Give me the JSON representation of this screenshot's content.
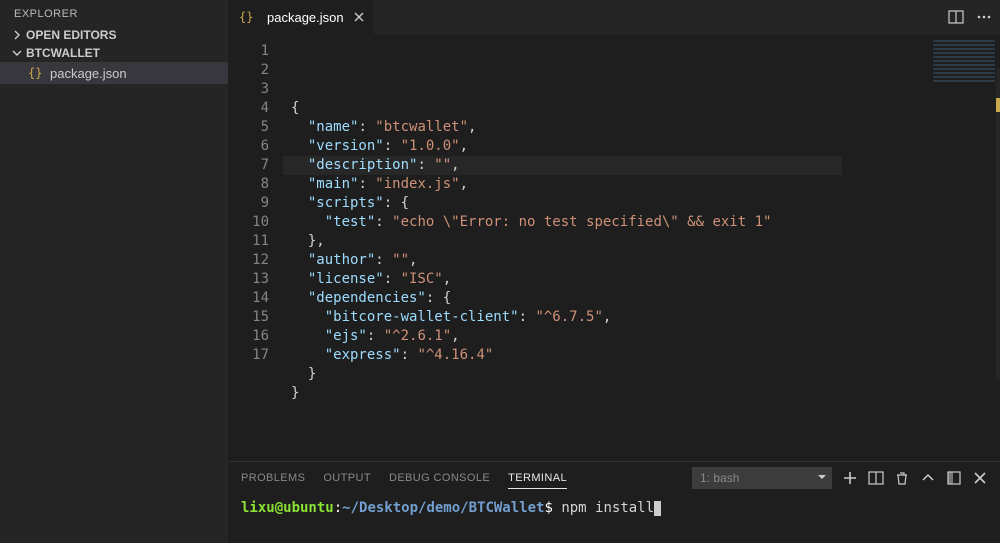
{
  "sidebar": {
    "title": "EXPLORER",
    "sections": [
      {
        "label": "OPEN EDITORS",
        "expanded": false
      },
      {
        "label": "BTCWALLET",
        "expanded": true
      }
    ],
    "files": [
      {
        "name": "package.json",
        "selected": true
      }
    ]
  },
  "tabs": [
    {
      "label": "package.json",
      "active": true
    }
  ],
  "terminal": {
    "panel_tabs": [
      "PROBLEMS",
      "OUTPUT",
      "DEBUG CONSOLE",
      "TERMINAL"
    ],
    "active_panel_tab": "TERMINAL",
    "select_label": "1: bash",
    "prompt_user": "lixu@ubuntu",
    "prompt_path": "~/Desktop/demo/BTCWallet",
    "command": "npm install"
  },
  "code": {
    "lines": [
      "{",
      "  \"name\": \"btcwallet\",",
      "  \"version\": \"1.0.0\",",
      "  \"description\": \"\",",
      "  \"main\": \"index.js\",",
      "  \"scripts\": {",
      "    \"test\": \"echo \\\"Error: no test specified\\\" && exit 1\"",
      "  },",
      "  \"author\": \"\",",
      "  \"license\": \"ISC\",",
      "  \"dependencies\": {",
      "    \"bitcore-wallet-client\": \"^6.7.5\",",
      "    \"ejs\": \"^2.6.1\",",
      "    \"express\": \"^4.16.4\"",
      "  }",
      "}",
      ""
    ]
  }
}
